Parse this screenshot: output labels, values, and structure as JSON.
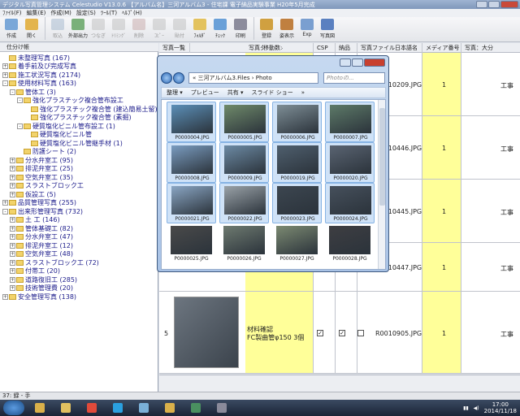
{
  "app": {
    "title": "デジタル写真管理システム Celestudio V13.0.6 【アルバム名】三河アルバム3 - 住宅課 電子納品実験事業 H20年5月完成"
  },
  "menu": [
    "ﾌｧｲﾙ(F)",
    "編集(E)",
    "作成(M)",
    "設定(S)",
    "ﾂｰﾙ(T)",
    "ﾍﾙﾌﾟ(H)"
  ],
  "toolbar": [
    {
      "label": "作成",
      "icon": "create-icon",
      "enabled": true
    },
    {
      "label": "開く",
      "icon": "open-folder-icon",
      "enabled": true
    },
    {
      "label": "",
      "icon": "",
      "enabled": false
    },
    {
      "label": "取込",
      "icon": "import-icon",
      "enabled": false
    },
    {
      "label": "外部出力",
      "icon": "export-icon",
      "enabled": true
    },
    {
      "label": "つなぎ",
      "icon": "connect-icon",
      "enabled": false
    },
    {
      "label": "ﾄﾘﾐﾝｸﾞ",
      "icon": "trim-icon",
      "enabled": false
    },
    {
      "label": "削除",
      "icon": "delete-icon",
      "enabled": false
    },
    {
      "label": "ｺﾋﾟｰ",
      "icon": "copy-icon",
      "enabled": false
    },
    {
      "label": "貼付",
      "icon": "paste-icon",
      "enabled": false
    },
    {
      "label": "ﾌｫﾙﾀﾞ",
      "icon": "folder-icon",
      "enabled": true
    },
    {
      "label": "ﾁｪｯｸ",
      "icon": "check-icon",
      "enabled": true
    },
    {
      "label": "印刷",
      "icon": "print-icon",
      "enabled": true
    },
    {
      "label": "",
      "icon": "",
      "enabled": false
    },
    {
      "label": "登録",
      "icon": "register-icon",
      "enabled": true
    },
    {
      "label": "姿表示",
      "icon": "display-icon",
      "enabled": true
    },
    {
      "label": "Exp",
      "icon": "exp-icon",
      "enabled": true
    },
    {
      "label": "写真図",
      "icon": "photo-chart-icon",
      "enabled": true
    }
  ],
  "tree_tab": "仕分け帳",
  "tree": [
    {
      "label": "未整理写真 (167)",
      "indent": 0,
      "expander": ""
    },
    {
      "label": "着手前及び完成写真",
      "indent": 0,
      "expander": "+"
    },
    {
      "label": "施工状況写真 (2174)",
      "indent": 0,
      "expander": "+"
    },
    {
      "label": "使用材料写真 (163)",
      "indent": 0,
      "expander": "-"
    },
    {
      "label": "管体工 (3)",
      "indent": 1,
      "expander": "-"
    },
    {
      "label": "強化プラスチック複合管布設工",
      "indent": 2,
      "expander": "-"
    },
    {
      "label": "強化プラスチック複合管 (建込簡易土留)",
      "indent": 3,
      "expander": ""
    },
    {
      "label": "強化プラスチック複合管 (素掘)",
      "indent": 3,
      "expander": ""
    },
    {
      "label": "硬質塩化ビニル管布設工 (1)",
      "indent": 2,
      "expander": "-"
    },
    {
      "label": "硬質塩化ビニル管",
      "indent": 3,
      "expander": ""
    },
    {
      "label": "硬質塩化ビニル管継手材 (1)",
      "indent": 3,
      "expander": ""
    },
    {
      "label": "防護シート (2)",
      "indent": 2,
      "expander": ""
    },
    {
      "label": "分水弁室工 (95)",
      "indent": 1,
      "expander": "+"
    },
    {
      "label": "排泥弁室工 (25)",
      "indent": 1,
      "expander": "+"
    },
    {
      "label": "空気弁室工 (35)",
      "indent": 1,
      "expander": "+"
    },
    {
      "label": "スラストブロック工",
      "indent": 1,
      "expander": "+"
    },
    {
      "label": "仮設工 (5)",
      "indent": 1,
      "expander": "+"
    },
    {
      "label": "品質管理写真 (255)",
      "indent": 0,
      "expander": "+"
    },
    {
      "label": "出来形管理写真 (732)",
      "indent": 0,
      "expander": "-"
    },
    {
      "label": "土 工 (146)",
      "indent": 1,
      "expander": "+"
    },
    {
      "label": "管体基礎工 (82)",
      "indent": 1,
      "expander": "+"
    },
    {
      "label": "分水弁室工 (47)",
      "indent": 1,
      "expander": "+"
    },
    {
      "label": "排泥弁室工 (12)",
      "indent": 1,
      "expander": "+"
    },
    {
      "label": "空気弁室工 (48)",
      "indent": 1,
      "expander": "+"
    },
    {
      "label": "スラストブロック工 (72)",
      "indent": 1,
      "expander": "+"
    },
    {
      "label": "付帯工 (20)",
      "indent": 1,
      "expander": "+"
    },
    {
      "label": "道路復旧工 (285)",
      "indent": 1,
      "expander": "+"
    },
    {
      "label": "技術管理費 (20)",
      "indent": 1,
      "expander": "+"
    },
    {
      "label": "安全管理写真 (138)",
      "indent": 0,
      "expander": "+"
    }
  ],
  "grid": {
    "header": {
      "view_tab": "写真一覧",
      "move_label": "移動数:",
      "col_title": "写真タイトル",
      "col_flag1": "CSP",
      "col_flag2": "納品",
      "col_filename": "写真ファイル日本語名",
      "col_media": "メディア番号",
      "col_category": "写真：大分"
    },
    "rows": [
      {
        "no": "",
        "title": "",
        "file": "R0010209.JPG",
        "media": "1",
        "category": "工事"
      },
      {
        "no": "",
        "title": "",
        "file": "R0010446.JPG",
        "media": "1",
        "category": "工事"
      },
      {
        "no": "",
        "title": "",
        "file": "R0010445.JPG",
        "media": "1",
        "category": "工事"
      },
      {
        "no": "",
        "title": "",
        "file": "R0010447.JPG",
        "media": "1",
        "category": "工事"
      },
      {
        "no": "5",
        "title": "材料確認",
        "title2": "FC製曲管φ150 3個",
        "file": "R0010905.JPG",
        "media": "1",
        "category": "工事",
        "flag1": "✓",
        "flag2": "✓"
      }
    ]
  },
  "statusbar": "37: 録 - 手",
  "explorer": {
    "address": "« 三河アルバム3.Files › Photo",
    "search_placeholder": "Photoの...",
    "commands": [
      "整理 ▾",
      "プレビュー",
      "共有 ▾",
      "スライド ショー",
      "»"
    ],
    "files": [
      {
        "name": "P0000004.JPG",
        "selected": true,
        "color": "#5b8fb8"
      },
      {
        "name": "P0000005.JPG",
        "selected": true,
        "color": "#6f8a6a"
      },
      {
        "name": "P0000006.JPG",
        "selected": true,
        "color": "#7e8e96"
      },
      {
        "name": "P0000007.JPG",
        "selected": true,
        "color": "#5d7a68"
      },
      {
        "name": "P0000008.JPG",
        "selected": true,
        "color": "#7a9cc0"
      },
      {
        "name": "P0000009.JPG",
        "selected": true,
        "color": "#6c8aa4"
      },
      {
        "name": "P0000019.JPG",
        "selected": true,
        "color": "#4f5f6e"
      },
      {
        "name": "P0000020.JPG",
        "selected": true,
        "color": "#5a6472"
      },
      {
        "name": "P0000021.JPG",
        "selected": true,
        "color": "#8aa6c4"
      },
      {
        "name": "P0000022.JPG",
        "selected": true,
        "color": "#9aa2a8"
      },
      {
        "name": "P0000023.JPG",
        "selected": true,
        "color": "#3c4650"
      },
      {
        "name": "P0000024.JPG",
        "selected": true,
        "color": "#46505c"
      },
      {
        "name": "P0000025.JPG",
        "selected": false,
        "color": "#4a4a4a"
      },
      {
        "name": "P0000026.JPG",
        "selected": false,
        "color": "#6e7a70"
      },
      {
        "name": "P0000027.JPG",
        "selected": false,
        "color": "#7c8a72"
      },
      {
        "name": "P0000028.JPG",
        "selected": false,
        "color": "#3e3e42"
      }
    ]
  },
  "taskbar": {
    "time": "17:00",
    "date": "2014/11/18",
    "apps": [
      "explorer-icon",
      "folder-icon",
      "chrome-icon",
      "skype-icon",
      "app-icon",
      "folder2-icon",
      "access-icon",
      "photo-app-icon"
    ]
  }
}
